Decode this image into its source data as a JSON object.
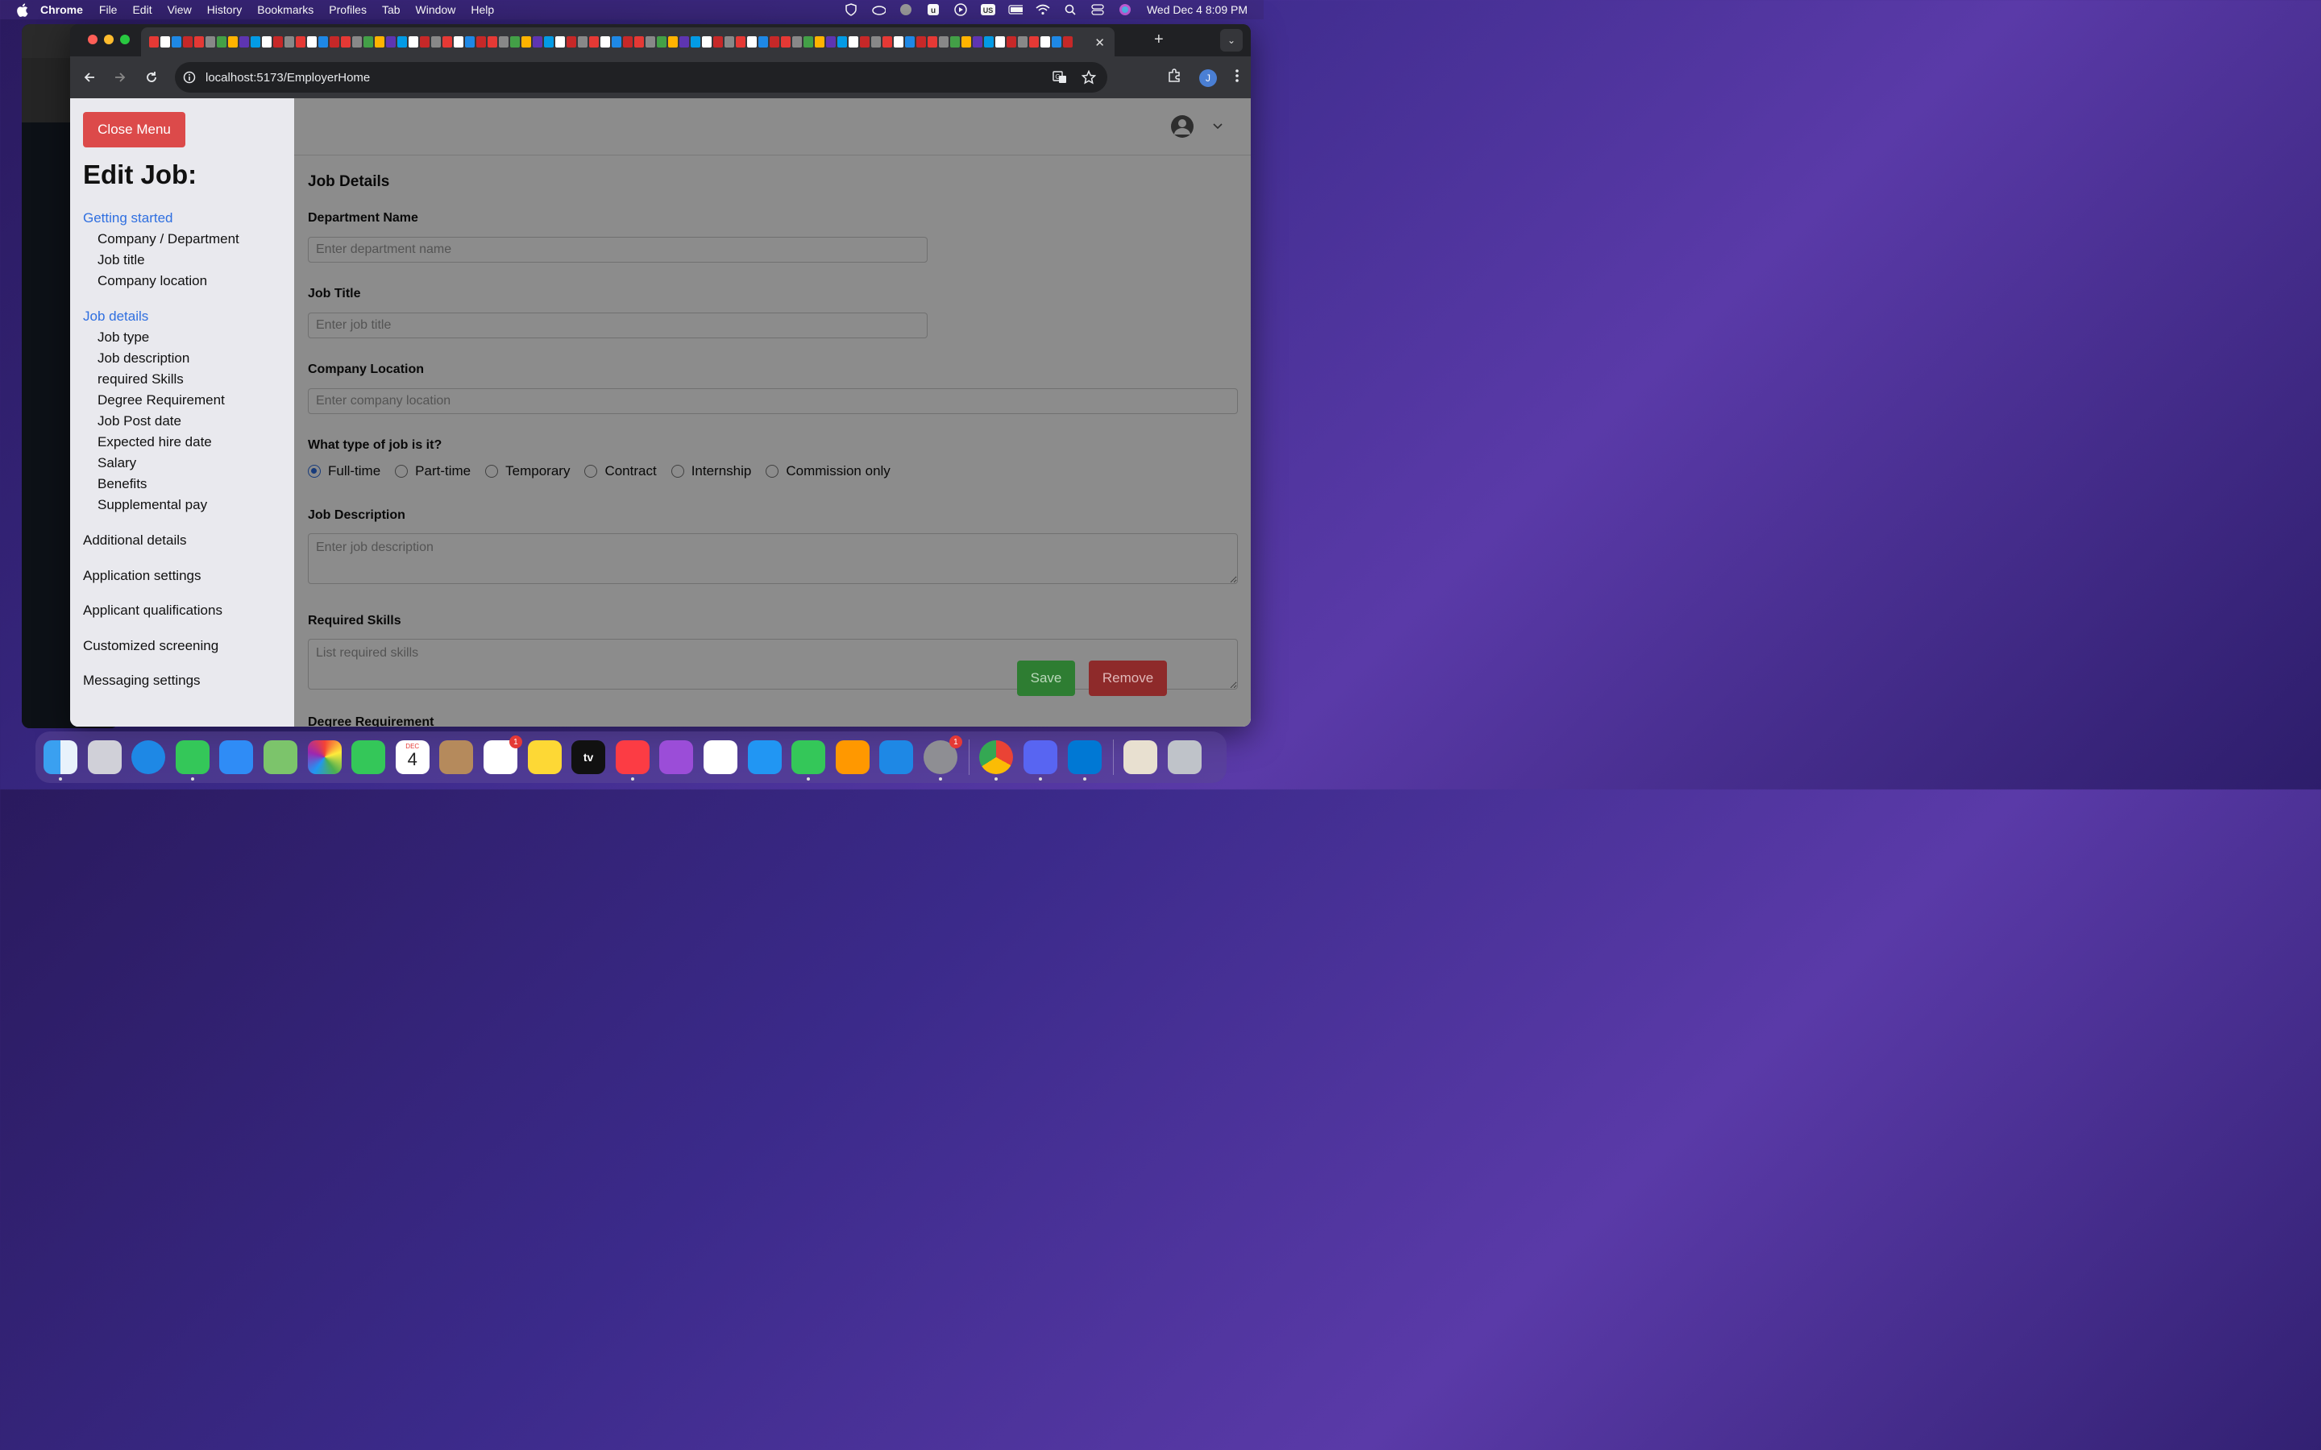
{
  "menubar": {
    "app": "Chrome",
    "items": [
      "File",
      "Edit",
      "View",
      "History",
      "Bookmarks",
      "Profiles",
      "Tab",
      "Window",
      "Help"
    ],
    "clock": "Wed Dec 4  8:09 PM",
    "status_icons": [
      "shield-icon",
      "cloud-icon",
      "globe-icon",
      "u-icon",
      "play-icon",
      "us-keyboard-icon",
      "battery-icon",
      "wifi-icon",
      "search-icon",
      "control-center-icon",
      "siri-icon"
    ]
  },
  "browser": {
    "url": "localhost:5173/EmployerHome",
    "profile_initial": "J"
  },
  "sidebar": {
    "close_label": "Close Menu",
    "title": "Edit Job:",
    "section1": "Getting started",
    "section1_items": [
      "Company / Department",
      "Job title",
      "Company location"
    ],
    "section2": "Job details",
    "section2_items": [
      "Job type",
      "Job description",
      "required Skills",
      "Degree Requirement",
      "Job Post date",
      "Expected hire date",
      "Salary",
      "Benefits",
      "Supplemental pay"
    ],
    "other_sections": [
      "Additional details",
      "Application settings",
      "Applicant qualifications",
      "Customized screening",
      "Messaging settings"
    ]
  },
  "form": {
    "heading": "Job Details",
    "department_label": "Department Name",
    "department_placeholder": "Enter department name",
    "title_label": "Job Title",
    "title_placeholder": "Enter job title",
    "location_label": "Company Location",
    "location_placeholder": "Enter company location",
    "jobtype_label": "What type of job is it?",
    "jobtypes": [
      "Full-time",
      "Part-time",
      "Temporary",
      "Contract",
      "Internship",
      "Commission only"
    ],
    "jobtype_selected": "Full-time",
    "description_label": "Job Description",
    "description_placeholder": "Enter job description",
    "skills_label": "Required Skills",
    "skills_placeholder": "List required skills",
    "next_label_partial": "Degree Requirement"
  },
  "actions": {
    "save": "Save",
    "remove": "Remove"
  },
  "dock": {
    "calendar_month": "DEC",
    "calendar_day": "4",
    "reminders_badge": "1",
    "settings_badge": "1",
    "tv_label": "tv"
  },
  "colors": {
    "accent_blue": "#2f6fe0",
    "close_red": "#dc4a4a",
    "save_green": "#2e7d32",
    "remove_red": "#c62828"
  }
}
